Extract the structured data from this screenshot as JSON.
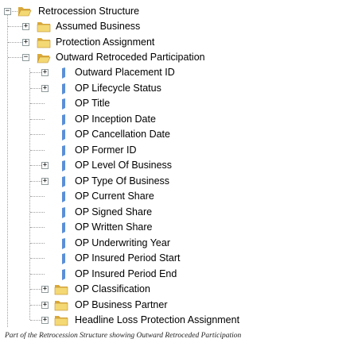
{
  "tree": {
    "root": {
      "label": "Retrocession Structure",
      "state": "expanded",
      "icon": "open-folder-icon"
    },
    "level1": [
      {
        "label": "Assumed Business",
        "state": "collapsed",
        "icon": "folder-icon"
      },
      {
        "label": "Protection Assignment",
        "state": "collapsed",
        "icon": "folder-icon"
      },
      {
        "label": "Outward Retroceded Participation",
        "state": "expanded",
        "icon": "open-folder-icon"
      }
    ],
    "children": [
      {
        "label": "Outward Placement ID",
        "expandable": true,
        "icon": "attribute-icon"
      },
      {
        "label": "OP Lifecycle Status",
        "expandable": true,
        "icon": "attribute-icon"
      },
      {
        "label": "OP Title",
        "expandable": false,
        "icon": "attribute-icon"
      },
      {
        "label": "OP Inception Date",
        "expandable": false,
        "icon": "attribute-icon"
      },
      {
        "label": "OP Cancellation Date",
        "expandable": false,
        "icon": "attribute-icon"
      },
      {
        "label": "OP Former ID",
        "expandable": false,
        "icon": "attribute-icon"
      },
      {
        "label": "OP Level Of Business",
        "expandable": true,
        "icon": "attribute-icon"
      },
      {
        "label": "OP Type Of Business",
        "expandable": true,
        "icon": "attribute-icon"
      },
      {
        "label": "OP Current Share",
        "expandable": false,
        "icon": "attribute-icon"
      },
      {
        "label": "OP Signed Share",
        "expandable": false,
        "icon": "attribute-icon"
      },
      {
        "label": "OP Written Share",
        "expandable": false,
        "icon": "attribute-icon"
      },
      {
        "label": "OP Underwriting Year",
        "expandable": false,
        "icon": "attribute-icon"
      },
      {
        "label": "OP Insured Period Start",
        "expandable": false,
        "icon": "attribute-icon"
      },
      {
        "label": "OP Insured Period End",
        "expandable": false,
        "icon": "attribute-icon"
      },
      {
        "label": "OP Classification",
        "expandable": true,
        "icon": "folder-icon"
      },
      {
        "label": "OP Business Partner",
        "expandable": true,
        "icon": "folder-icon"
      },
      {
        "label": "Headline Loss Protection Assignment",
        "expandable": true,
        "icon": "folder-icon"
      }
    ]
  },
  "caption": "Part of the Retrocession Structure showing Outward Retroceded Participation",
  "colors": {
    "folder": "#f3d873",
    "folder_dark": "#d9a93b",
    "attribute": "#5b8fd6",
    "tree_line": "#a0a0a0"
  }
}
